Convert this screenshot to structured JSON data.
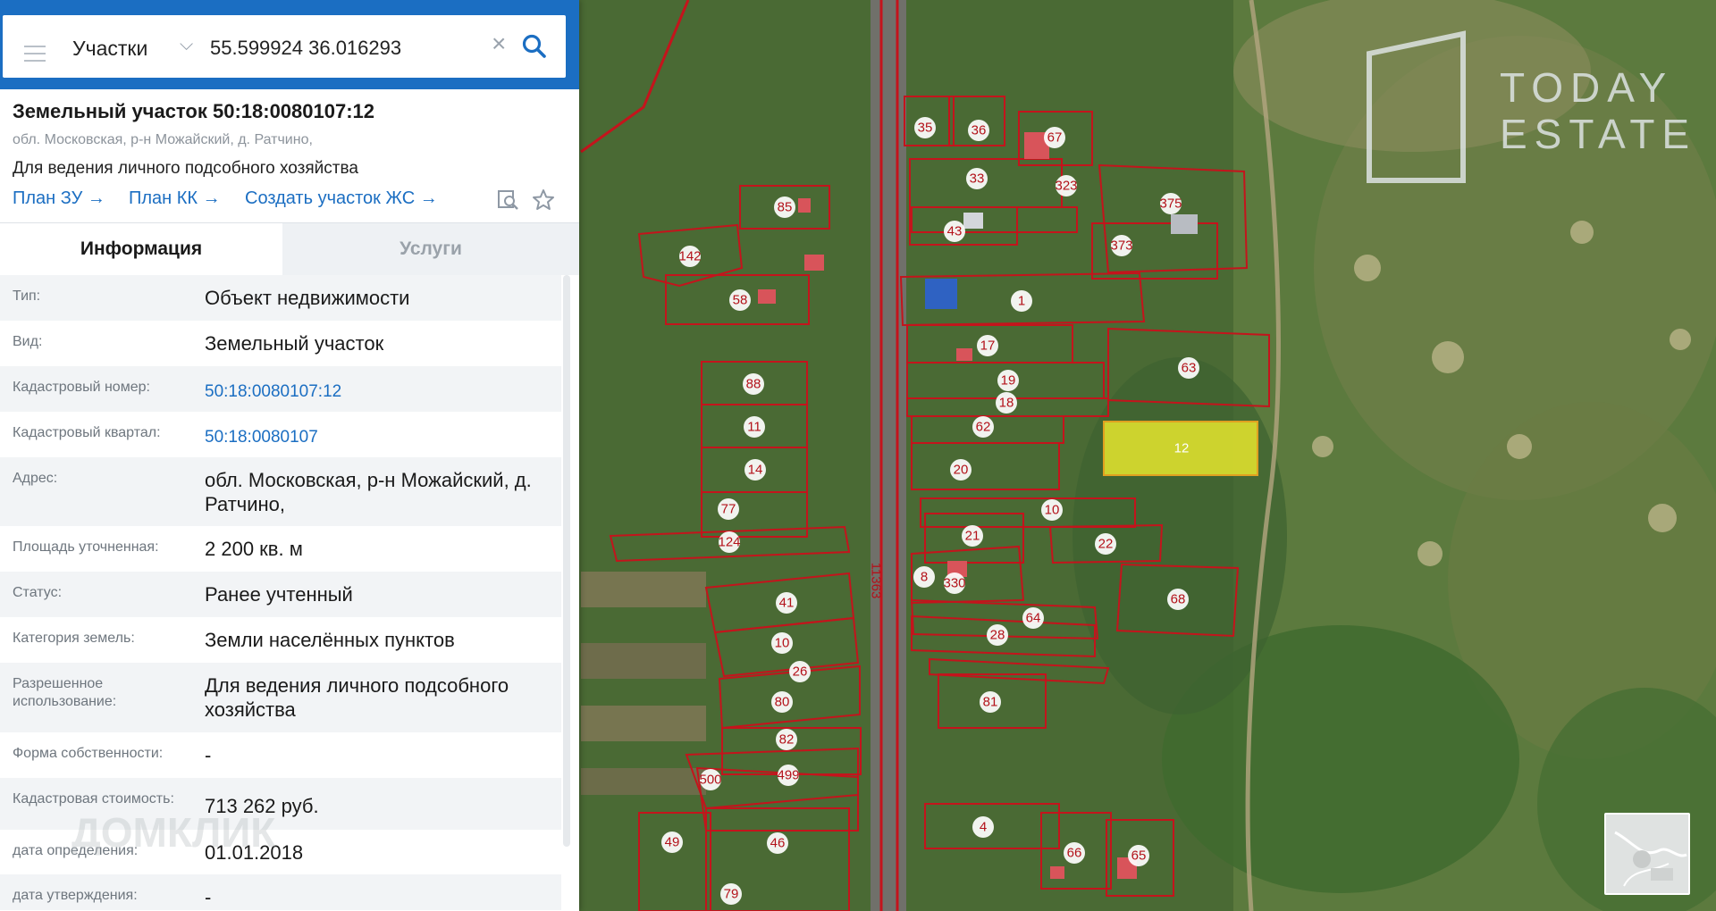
{
  "search": {
    "layer": "Участки",
    "coordinates": "55.599924 36.016293"
  },
  "card": {
    "title": "Земельный участок 50:18:0080107:12",
    "address": "обл. Московская, р-н Можайский, д. Ратчино,",
    "purpose": "Для ведения личного подсобного хозяйства",
    "links": [
      {
        "label": "План ЗУ"
      },
      {
        "label": "План КК"
      },
      {
        "label": "Создать участок ЖС"
      }
    ],
    "arrow": "→"
  },
  "tabs": {
    "info": "Информация",
    "services": "Услуги"
  },
  "rows": [
    {
      "label": "Тип:",
      "value": "Объект недвижимости"
    },
    {
      "label": "Вид:",
      "value": "Земельный участок"
    },
    {
      "label": "Кадастровый номер:",
      "value": "50:18:0080107:12"
    },
    {
      "label": "Кадастровый квартал:",
      "value": "50:18:0080107"
    },
    {
      "label": "Адрес:",
      "value": "обл. Московская, р-н Можайский, д. Ратчино,"
    },
    {
      "label": "Площадь уточненная:",
      "value": "2 200 кв. м"
    },
    {
      "label": "Статус:",
      "value": "Ранее учтенный"
    },
    {
      "label": "Категория земель:",
      "value": "Земли населённых пунктов"
    },
    {
      "label": "Разрешенное использование:",
      "value": "Для ведения личного подсобного хозяйства"
    },
    {
      "label": "Форма собственности:",
      "value": "-"
    },
    {
      "label": "Кадастровая стоимость:",
      "value": "713 262 руб."
    },
    {
      "label": "дата определения:",
      "value": "01.01.2018"
    },
    {
      "label": "дата утверждения:",
      "value": "-"
    }
  ],
  "map": {
    "road_label": "11363",
    "parcel_numbers": [
      "35",
      "36",
      "67",
      "33",
      "323",
      "375",
      "85",
      "43",
      "373",
      "142",
      "1",
      "58",
      "17",
      "63",
      "19",
      "88",
      "18",
      "62",
      "11",
      "12",
      "20",
      "14",
      "10",
      "77",
      "21",
      "22",
      "124",
      "8",
      "330",
      "41",
      "68",
      "64",
      "28",
      "10",
      "81",
      "26",
      "80",
      "82",
      "499",
      "500",
      "4",
      "49",
      "46",
      "66",
      "65",
      "79"
    ],
    "selected_parcel": "12",
    "highlight_color": "#e6e62e",
    "border_color": "#c4141c"
  },
  "branding": {
    "logo_line1": "TODAY",
    "logo_line2": "ESTATE",
    "watermark": "ДОМКЛИК"
  }
}
